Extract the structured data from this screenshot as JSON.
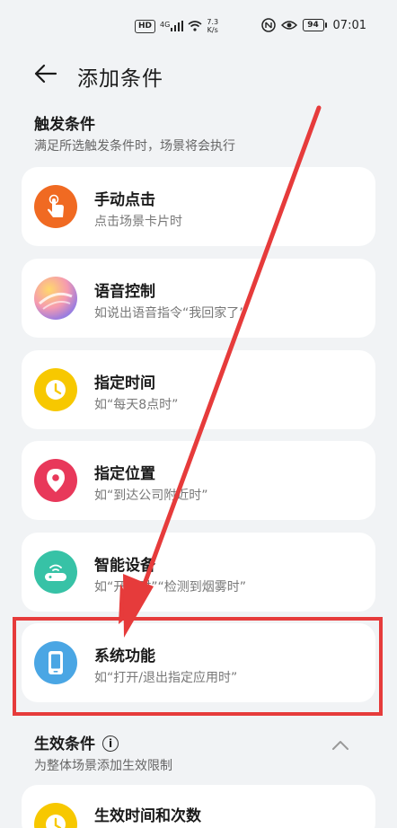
{
  "status_bar": {
    "hd": "HD",
    "network": "4G",
    "speed_value": "7.3",
    "speed_unit": "K/s",
    "battery": "94",
    "time": "07:01"
  },
  "header": {
    "title": "添加条件"
  },
  "trigger_section": {
    "title": "触发条件",
    "subtitle": "满足所选触发条件时，场景将会执行"
  },
  "conditions": [
    {
      "title": "手动点击",
      "subtitle": "点击场景卡片时",
      "icon": "hand-tap-icon",
      "color": "#f06a22"
    },
    {
      "title": "语音控制",
      "subtitle": "如说出语音指令“我回家了”",
      "icon": "voice-assistant-icon",
      "color": "#e6849a"
    },
    {
      "title": "指定时间",
      "subtitle": "如“每天8点时”",
      "icon": "clock-icon",
      "color": "#f7c800"
    },
    {
      "title": "指定位置",
      "subtitle": "如“到达公司附近时”",
      "icon": "location-pin-icon",
      "color": "#e8385a"
    },
    {
      "title": "智能设备",
      "subtitle": "如“开灯时”“检测到烟雾时”",
      "icon": "smart-device-icon",
      "color": "#37c2a6"
    },
    {
      "title": "系统功能",
      "subtitle": "如“打开/退出指定应用时”",
      "icon": "phone-icon",
      "color": "#4aa6e4"
    }
  ],
  "effective_section": {
    "title": "生效条件",
    "subtitle": "为整体场景添加生效限制"
  },
  "effective_items": [
    {
      "title": "生效时间和次数",
      "icon": "clock-icon",
      "color": "#f7c800"
    }
  ],
  "colors": {
    "highlight": "#e63b3b",
    "arrow": "#e63b3b",
    "background": "#f1f3f5"
  }
}
